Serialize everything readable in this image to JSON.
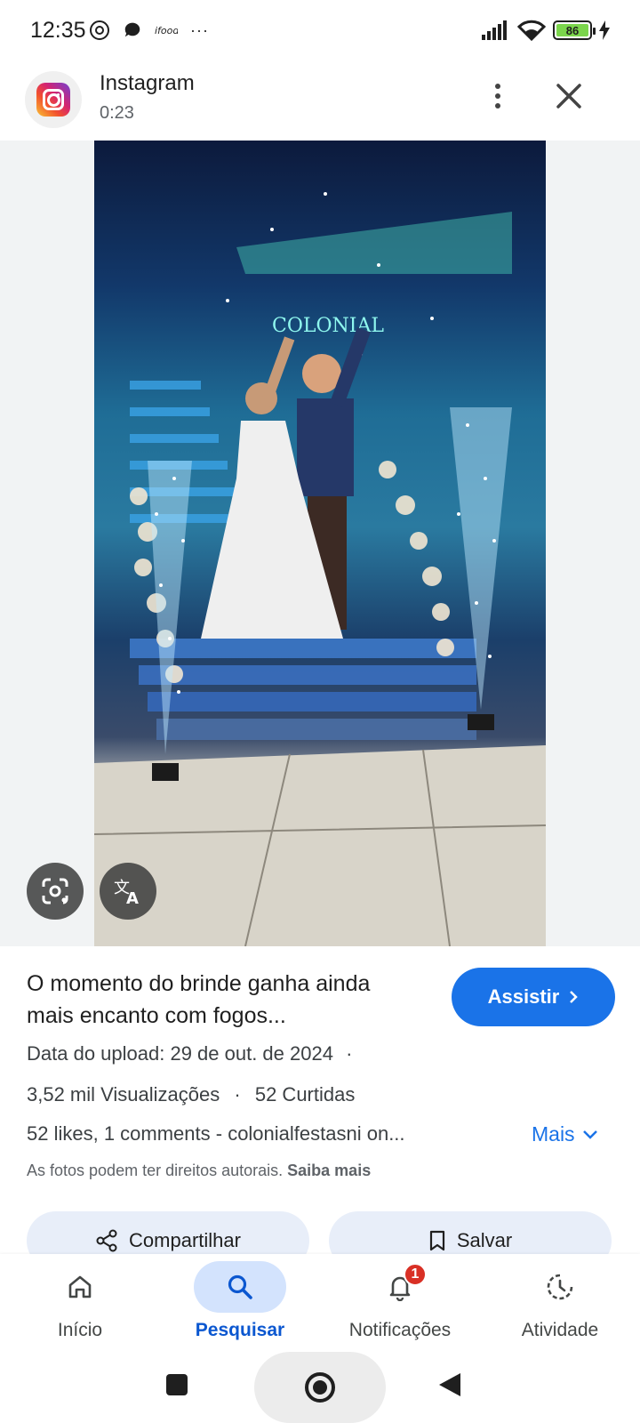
{
  "status_bar": {
    "time": "12:35",
    "battery_level": "86",
    "overflow": "···"
  },
  "source": {
    "name": "Instagram",
    "duration": "0:23"
  },
  "result": {
    "title": "O momento do brinde ganha ainda mais encanto com fogos...",
    "watch_label": "Assistir",
    "upload_date": "Data do upload: 29 de out. de 2024",
    "views": "3,52 mil Visualizações",
    "likes": "52 Curtidas",
    "description": "52 likes, 1 comments - colonialfestasni on...",
    "more_label": "Mais",
    "copyright_text": "As fotos podem ter direitos autorais.",
    "learn_more_label": "Saiba mais"
  },
  "actions": {
    "share_label": "Compartilhar",
    "save_label": "Salvar"
  },
  "bottom_nav": {
    "items": [
      {
        "label": "Início",
        "icon": "home-icon",
        "active": false
      },
      {
        "label": "Pesquisar",
        "icon": "search-icon",
        "active": true
      },
      {
        "label": "Notificações",
        "icon": "bell-icon",
        "active": false,
        "badge": "1"
      },
      {
        "label": "Atividade",
        "icon": "activity-icon",
        "active": false
      }
    ]
  },
  "colors": {
    "accent": "#1a73e8",
    "active_nav_bg": "#d3e3fd",
    "badge": "#d93025"
  }
}
